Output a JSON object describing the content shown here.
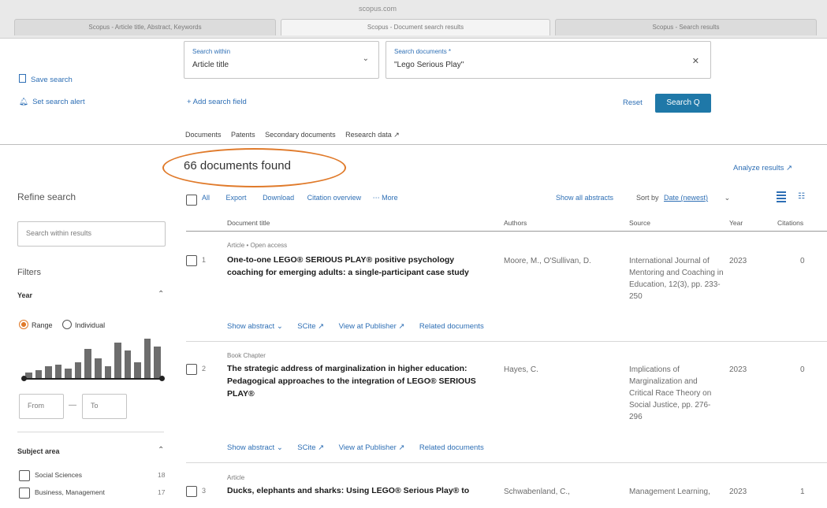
{
  "browser": {
    "url": "scopus.com",
    "tabs": [
      {
        "label": "Scopus - Article title, Abstract, Keywords"
      },
      {
        "label": "Scopus - Document search results"
      },
      {
        "label": "Scopus - Search results"
      }
    ]
  },
  "search": {
    "field1_label": "Search within",
    "field1_value": "Article title",
    "field2_label": "Search documents *",
    "field2_value": "\"Lego Serious Play\"",
    "add_field": "+ Add search field",
    "reset": "Reset",
    "search_btn": "Search Q"
  },
  "left_actions": {
    "save_search": "Save search",
    "set_alert": "Set search alert"
  },
  "result_tabs": [
    "Documents",
    "Patents",
    "Secondary documents",
    "Research data ↗"
  ],
  "results": {
    "count_text": "66 documents found",
    "analyze": "Analyze results ↗"
  },
  "refine": {
    "title": "Refine search",
    "search_placeholder": "Search within results",
    "filters": "Filters",
    "year": "Year",
    "range": "Range",
    "individual": "Individual",
    "from_placeholder": "From",
    "to_placeholder": "To",
    "histogram": [
      3,
      4,
      6,
      7,
      5,
      8,
      15,
      10,
      6,
      18,
      14,
      8,
      20,
      16
    ],
    "subject_area": "Subject area",
    "subjects": [
      {
        "label": "Social Sciences",
        "count": "18"
      },
      {
        "label": "Business, Management",
        "count": "17"
      }
    ]
  },
  "toolbar": {
    "all": "All",
    "export": "Export",
    "download": "Download",
    "citation_overview": "Citation overview",
    "more": "More",
    "show_all_abstracts": "Show all abstracts",
    "sort_by_label": "Sort by",
    "sort_value": "Date (newest)"
  },
  "columns": {
    "title": "Document title",
    "authors": "Authors",
    "source": "Source",
    "year": "Year",
    "citations": "Citations"
  },
  "rows": [
    {
      "num": "1",
      "type": "Article • Open access",
      "title": "One-to-one LEGO® SERIOUS PLAY® positive psychology coaching for emerging adults: a single-participant case study",
      "authors": "Moore, M., O'Sullivan, D.",
      "source": "International Journal of Mentoring and Coaching in Education, 12(3), pp. 233-250",
      "year": "2023",
      "cites": "0",
      "show_abstract": "Show abstract",
      "scite": "SCite ↗",
      "view_publisher": "View at Publisher ↗",
      "related": "Related documents"
    },
    {
      "num": "2",
      "type": "Book Chapter",
      "title": "The strategic address of marginalization in higher education: Pedagogical approaches to the integration of LEGO® SERIOUS PLAY®",
      "authors": "Hayes, C.",
      "source": "Implications of Marginalization and Critical Race Theory on Social Justice, pp. 276-296",
      "year": "2023",
      "cites": "0",
      "show_abstract": "Show abstract",
      "scite": "SCite ↗",
      "view_publisher": "View at Publisher ↗",
      "related": "Related documents"
    },
    {
      "num": "3",
      "type": "Article",
      "title": "Ducks, elephants and sharks: Using LEGO® Serious Play® to",
      "authors": "Schwabenland, C.,",
      "source": "Management Learning,",
      "year": "2023",
      "cites": "1"
    }
  ],
  "colors": {
    "accent": "#2e6fb5",
    "search_button": "#1f78a8",
    "highlight": "#e07a2a"
  }
}
